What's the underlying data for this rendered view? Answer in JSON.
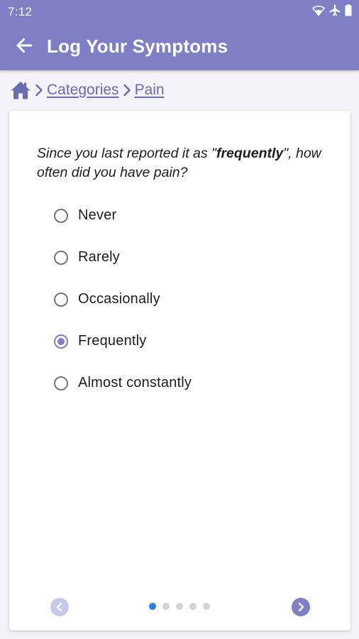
{
  "status_bar": {
    "time": "7:12",
    "icons": [
      "wifi-icon",
      "airplane-icon",
      "battery-icon"
    ]
  },
  "app_bar": {
    "back_icon": "arrow-left-icon",
    "title": "Log Your Symptoms"
  },
  "breadcrumb": {
    "home_icon": "home-icon",
    "items": [
      {
        "label": "Categories"
      },
      {
        "label": "Pain"
      }
    ]
  },
  "question": {
    "prefix": "Since you last reported it as \"",
    "emphasis": "frequently",
    "suffix": "\", how often did you have pain?"
  },
  "options": [
    {
      "label": "Never",
      "selected": false
    },
    {
      "label": "Rarely",
      "selected": false
    },
    {
      "label": "Occasionally",
      "selected": false
    },
    {
      "label": "Frequently",
      "selected": true
    },
    {
      "label": "Almost constantly",
      "selected": false
    }
  ],
  "pager": {
    "page_count": 5,
    "current_page": 1
  },
  "colors": {
    "primary": "#7f7fc6",
    "link": "#6b6bb0",
    "active_dot": "#2f7ee8",
    "inactive_dot": "#d3d3d3",
    "background": "#f3f2f8"
  }
}
